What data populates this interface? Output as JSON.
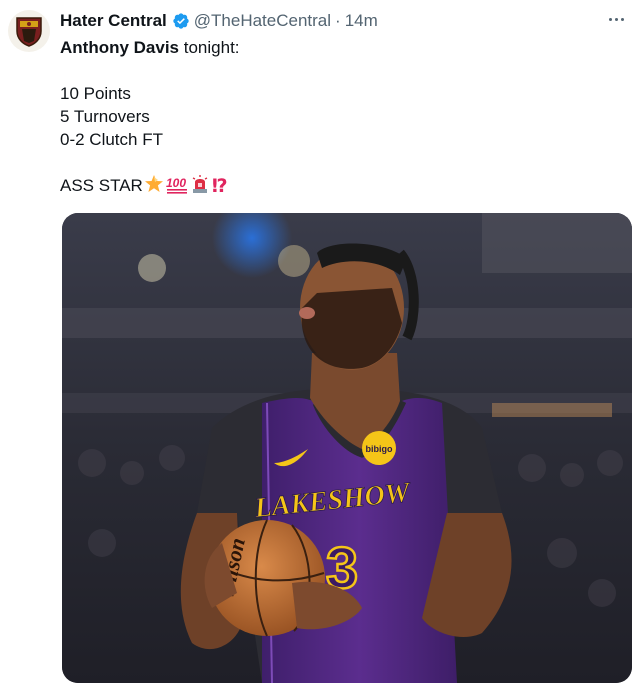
{
  "author": {
    "display_name": "Hater Central",
    "handle": "@TheHateCentral",
    "separator": "·",
    "timestamp": "14m"
  },
  "tweet": {
    "lines": [
      {
        "bold": "Anthony Davis",
        "rest": " tonight:"
      },
      {
        "text": "10 Points"
      },
      {
        "text": "5 Turnovers"
      },
      {
        "text": "0-2 Clutch FT"
      },
      {
        "text": "ASS STAR"
      }
    ],
    "emojis": [
      "star-emoji",
      "hundred-points-emoji",
      "police-light-emoji",
      "exclamation-question-emoji"
    ],
    "qmark": "⁉"
  },
  "media": {
    "jersey_text": "LAKESHOW",
    "jersey_number": "3",
    "sponsor_patch": "bibigo",
    "ball_brand": "Wilson"
  },
  "colors": {
    "verified": "#1d9bf0",
    "jersey_purple": "#5b2d8e",
    "jersey_gold": "#f5c518",
    "muted": "#536471",
    "alert_red": "#e0245e"
  }
}
